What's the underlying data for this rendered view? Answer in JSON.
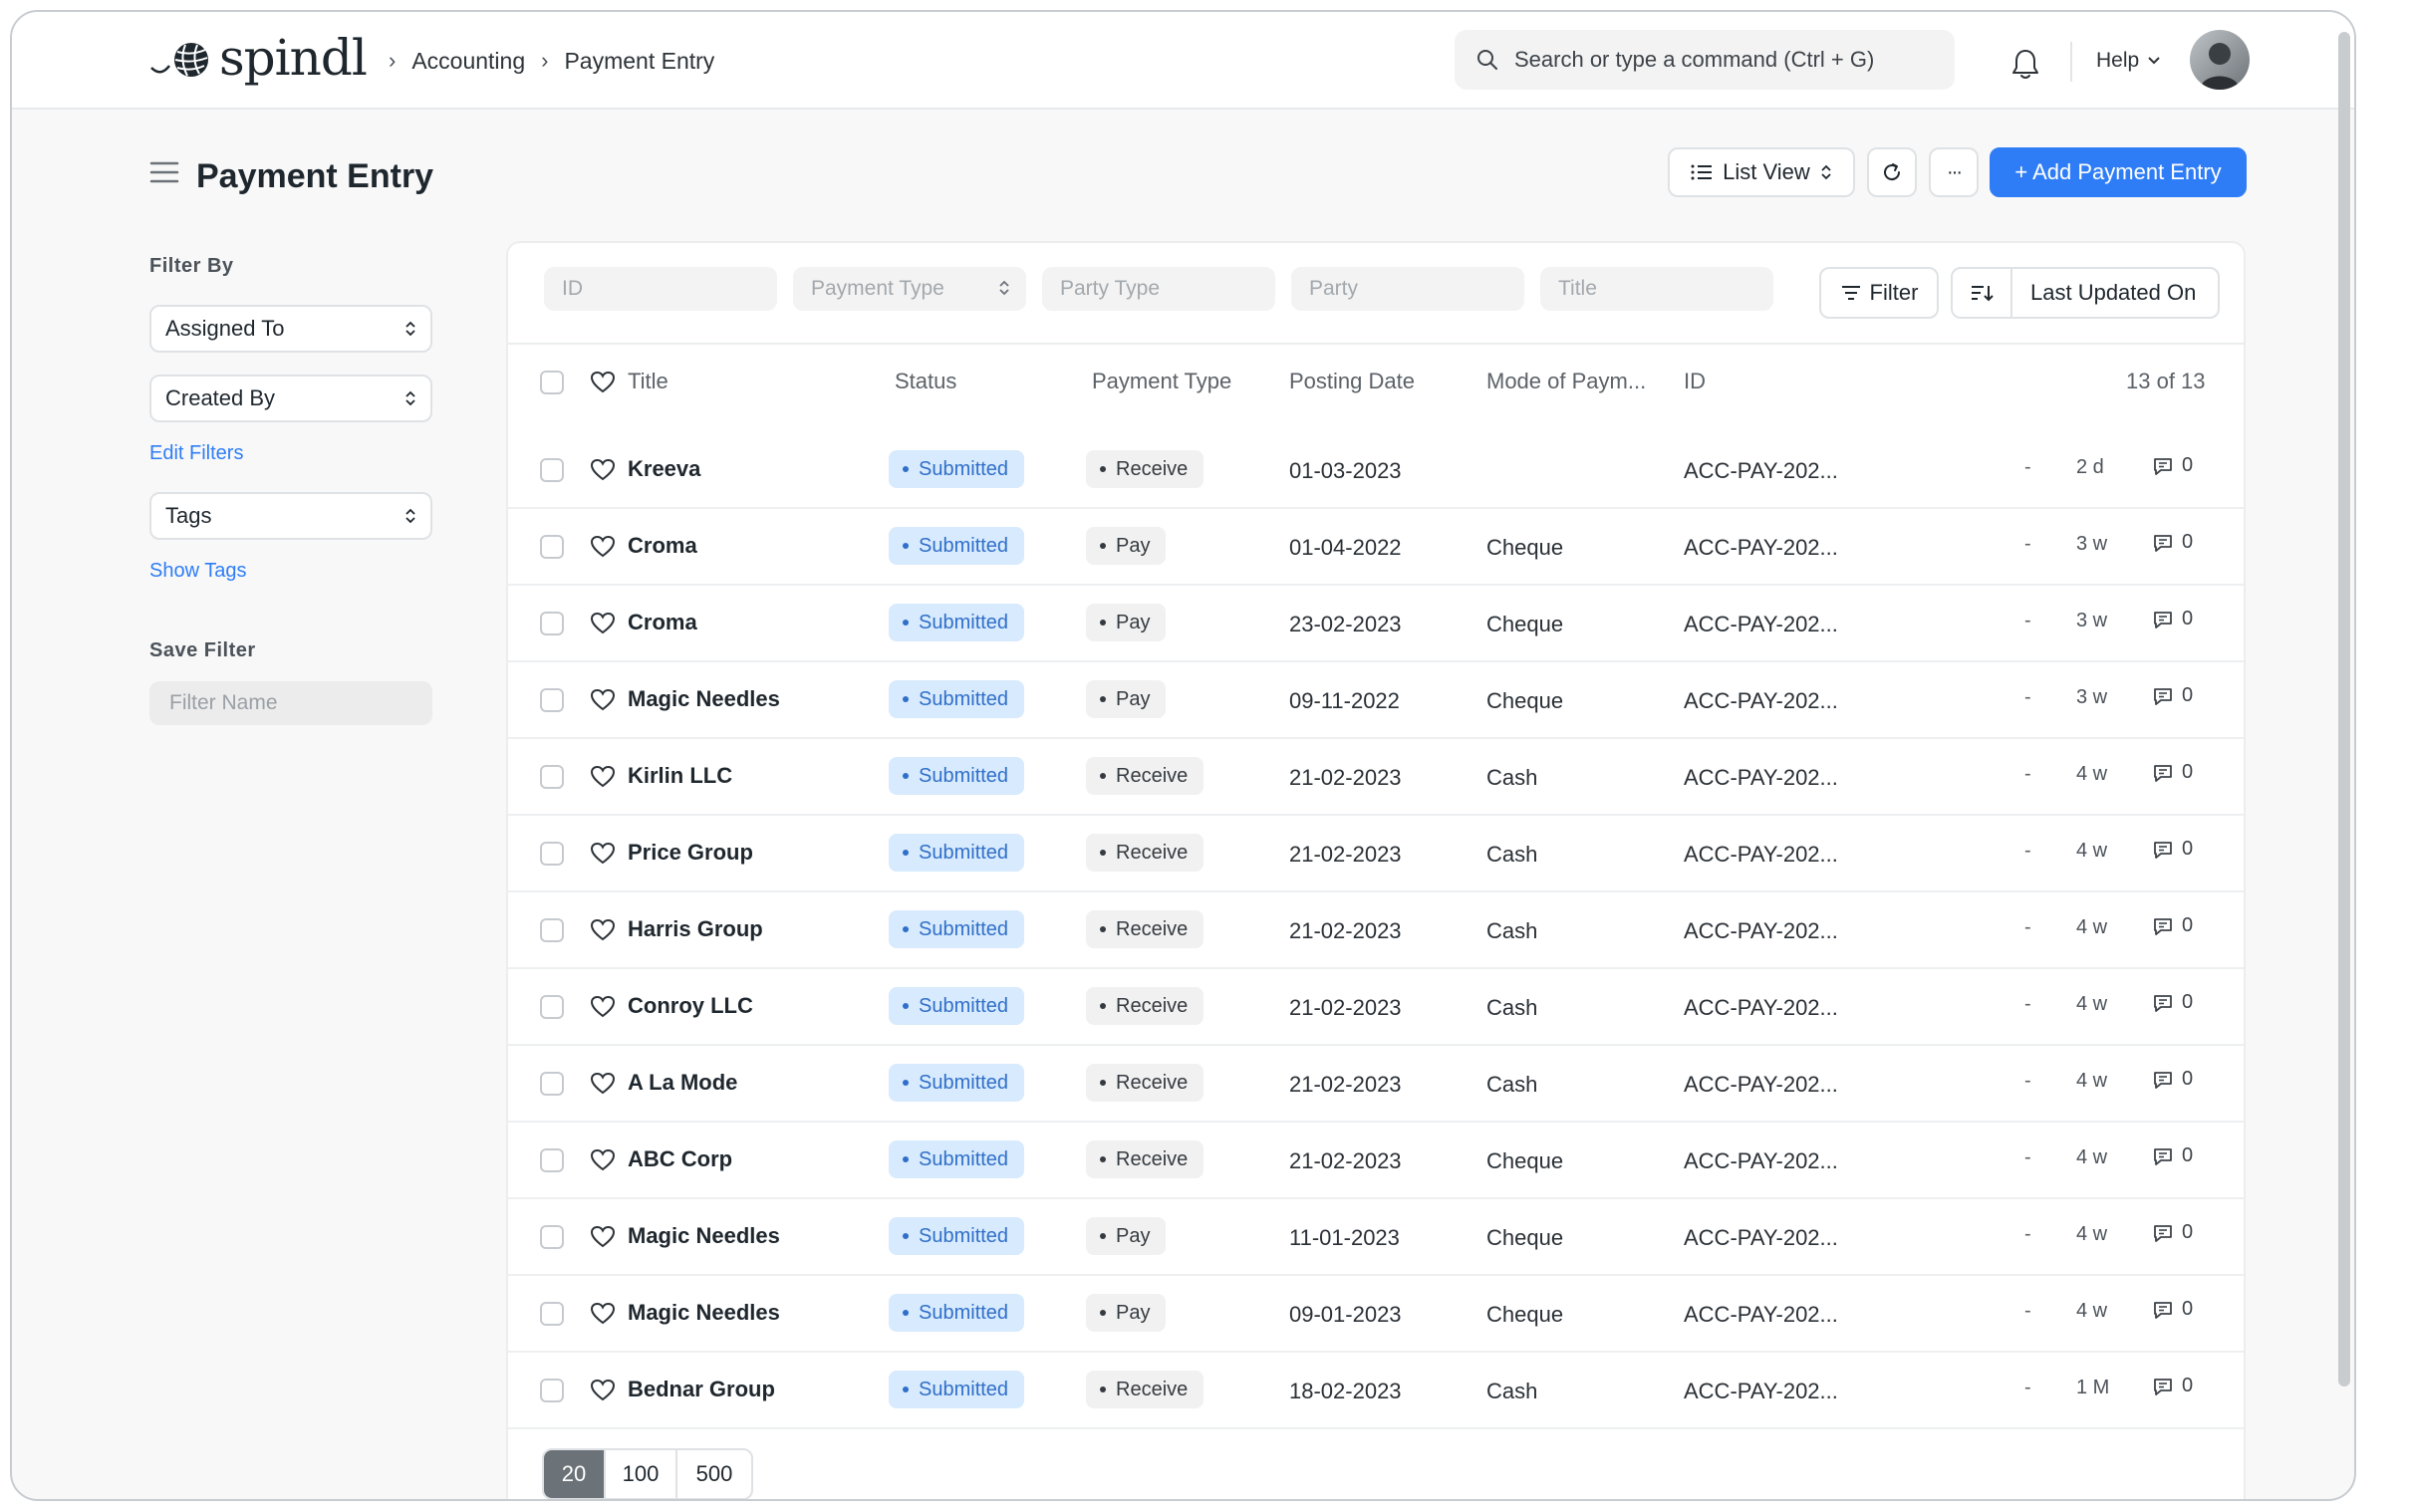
{
  "app": {
    "logo_text": "spindl"
  },
  "breadcrumb": [
    "Accounting",
    "Payment Entry"
  ],
  "search": {
    "placeholder": "Search or type a command (Ctrl + G)"
  },
  "nav": {
    "help_label": "Help"
  },
  "page": {
    "title": "Payment Entry"
  },
  "toolbar": {
    "view_label": "List View",
    "more_label": "···",
    "add_label": "+ Add Payment Entry"
  },
  "sidebar": {
    "filter_by_label": "Filter By",
    "assigned_to": "Assigned To",
    "created_by": "Created By",
    "edit_filters": "Edit Filters",
    "tags": "Tags",
    "show_tags": "Show Tags",
    "save_filter_label": "Save Filter",
    "filter_name_placeholder": "Filter Name"
  },
  "filters": {
    "id_placeholder": "ID",
    "payment_type_placeholder": "Payment Type",
    "party_type_placeholder": "Party Type",
    "party_placeholder": "Party",
    "title_placeholder": "Title",
    "filter_button": "Filter",
    "sort_label": "Last Updated On"
  },
  "columns": {
    "title": "Title",
    "status": "Status",
    "payment_type": "Payment Type",
    "posting_date": "Posting Date",
    "mode": "Mode of Paym...",
    "id": "ID",
    "count": "13 of 13"
  },
  "colors": {
    "accent": "#2f7df6",
    "status_bg": "#d8eafd",
    "status_text": "#2f6fc9"
  },
  "rows": [
    {
      "title": "Kreeva",
      "status": "Submitted",
      "type": "Receive",
      "date": "01-03-2023",
      "mode": "",
      "id": "ACC-PAY-202...",
      "dash": "-",
      "ago": "2 d",
      "comments": "0"
    },
    {
      "title": "Croma",
      "status": "Submitted",
      "type": "Pay",
      "date": "01-04-2022",
      "mode": "Cheque",
      "id": "ACC-PAY-202...",
      "dash": "-",
      "ago": "3 w",
      "comments": "0"
    },
    {
      "title": "Croma",
      "status": "Submitted",
      "type": "Pay",
      "date": "23-02-2023",
      "mode": "Cheque",
      "id": "ACC-PAY-202...",
      "dash": "-",
      "ago": "3 w",
      "comments": "0"
    },
    {
      "title": "Magic Needles",
      "status": "Submitted",
      "type": "Pay",
      "date": "09-11-2022",
      "mode": "Cheque",
      "id": "ACC-PAY-202...",
      "dash": "-",
      "ago": "3 w",
      "comments": "0"
    },
    {
      "title": "Kirlin LLC",
      "status": "Submitted",
      "type": "Receive",
      "date": "21-02-2023",
      "mode": "Cash",
      "id": "ACC-PAY-202...",
      "dash": "-",
      "ago": "4 w",
      "comments": "0"
    },
    {
      "title": "Price Group",
      "status": "Submitted",
      "type": "Receive",
      "date": "21-02-2023",
      "mode": "Cash",
      "id": "ACC-PAY-202...",
      "dash": "-",
      "ago": "4 w",
      "comments": "0"
    },
    {
      "title": "Harris Group",
      "status": "Submitted",
      "type": "Receive",
      "date": "21-02-2023",
      "mode": "Cash",
      "id": "ACC-PAY-202...",
      "dash": "-",
      "ago": "4 w",
      "comments": "0"
    },
    {
      "title": "Conroy LLC",
      "status": "Submitted",
      "type": "Receive",
      "date": "21-02-2023",
      "mode": "Cash",
      "id": "ACC-PAY-202...",
      "dash": "-",
      "ago": "4 w",
      "comments": "0"
    },
    {
      "title": "A La Mode",
      "status": "Submitted",
      "type": "Receive",
      "date": "21-02-2023",
      "mode": "Cash",
      "id": "ACC-PAY-202...",
      "dash": "-",
      "ago": "4 w",
      "comments": "0"
    },
    {
      "title": "ABC Corp",
      "status": "Submitted",
      "type": "Receive",
      "date": "21-02-2023",
      "mode": "Cheque",
      "id": "ACC-PAY-202...",
      "dash": "-",
      "ago": "4 w",
      "comments": "0"
    },
    {
      "title": "Magic Needles",
      "status": "Submitted",
      "type": "Pay",
      "date": "11-01-2023",
      "mode": "Cheque",
      "id": "ACC-PAY-202...",
      "dash": "-",
      "ago": "4 w",
      "comments": "0"
    },
    {
      "title": "Magic Needles",
      "status": "Submitted",
      "type": "Pay",
      "date": "09-01-2023",
      "mode": "Cheque",
      "id": "ACC-PAY-202...",
      "dash": "-",
      "ago": "4 w",
      "comments": "0"
    },
    {
      "title": "Bednar Group",
      "status": "Submitted",
      "type": "Receive",
      "date": "18-02-2023",
      "mode": "Cash",
      "id": "ACC-PAY-202...",
      "dash": "-",
      "ago": "1 M",
      "comments": "0"
    }
  ],
  "pagination": [
    "20",
    "100",
    "500"
  ]
}
